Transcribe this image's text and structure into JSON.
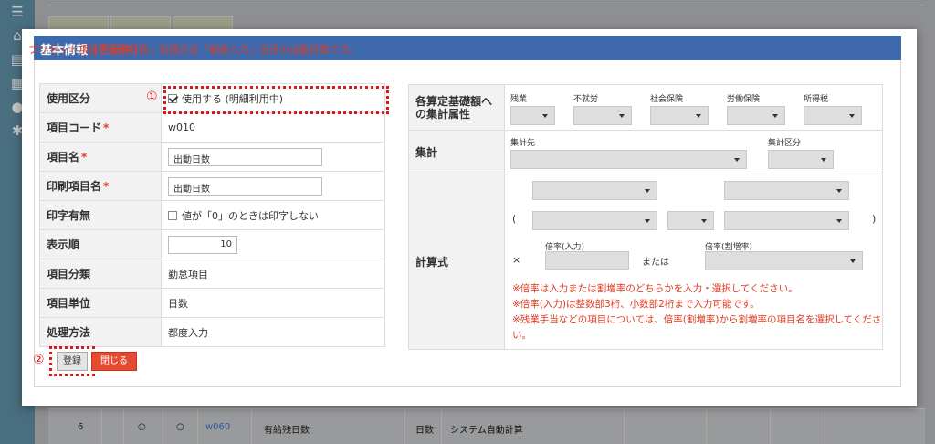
{
  "background": {
    "sidebar_icons": [
      "menu-icon",
      "home-icon",
      "document-icon",
      "calendar-icon",
      "user-gear-icon",
      "settings-icon"
    ],
    "row": {
      "no": "6",
      "c1": "○",
      "c2": "○",
      "code": "w060",
      "name": "有給残日数",
      "unit": "日数",
      "method": "システム自動計算"
    }
  },
  "modal": {
    "title": "基本情報",
    "status": "(更新中)",
    "notice": "プリセット項目「出動日数」処理方法「都度入力」当月の出勤日数です。"
  },
  "left": {
    "usage_label": "使用区分",
    "usage_checkbox_label": "使用する (明細利用中)",
    "code_label": "項目コード",
    "code_value": "w010",
    "name_label": "項目名",
    "name_value": "出動日数",
    "print_name_label": "印刷項目名",
    "print_name_value": "出動日数",
    "print_flag_label": "印字有無",
    "print_flag_checkbox_label": "値が「0」のときは印字しない",
    "order_label": "表示順",
    "order_value": "10",
    "category_label": "項目分類",
    "category_value": "勤怠項目",
    "unit_label": "項目単位",
    "unit_value": "日数",
    "method_label": "処理方法",
    "method_value": "都度入力",
    "required_mark": "*"
  },
  "right": {
    "attr_label": "各算定基礎額への集計属性",
    "attr_items": [
      "残業",
      "不就労",
      "社会保険",
      "労働保険",
      "所得税"
    ],
    "sum_label": "集計",
    "sum_dest_label": "集計先",
    "sum_type_label": "集計区分",
    "calc_label": "計算式",
    "paren_open": "(",
    "paren_close": ")",
    "times": "×",
    "rate_input_label": "倍率(入力)",
    "or_text": "または",
    "rate_premium_label": "倍率(割増率)",
    "notes": [
      "※倍率は入力または割増率のどちらかを入力・選択してください。",
      "※倍率(入力)は整数部3桁、小数部2桁まで入力可能です。",
      "※残業手当などの項目については、倍率(割増率)から割増率の項目名を選択してください。"
    ]
  },
  "buttons": {
    "register": "登録",
    "close": "閉じる"
  },
  "annotations": {
    "one": "①",
    "two": "②"
  }
}
